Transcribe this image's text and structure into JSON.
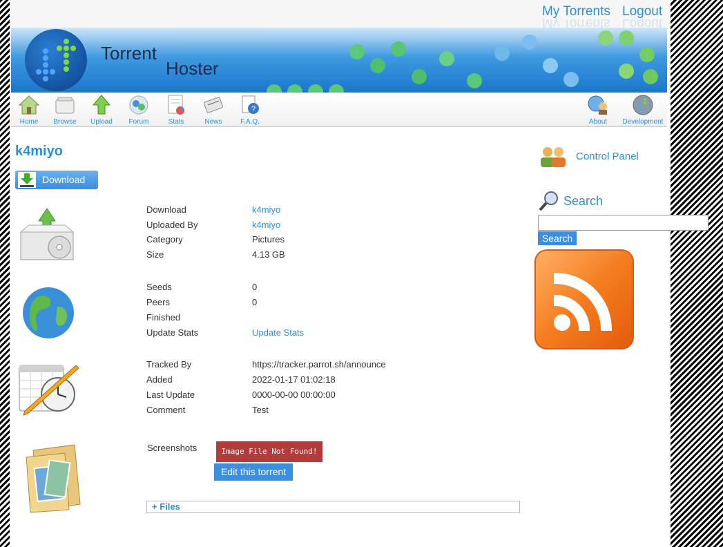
{
  "header": {
    "my_torrents": "My Torrents",
    "logout": "Logout",
    "banner_title_1": "Torrent",
    "banner_title_2": "Hoster"
  },
  "nav": {
    "items": [
      {
        "label": "Home",
        "icon": "home-icon"
      },
      {
        "label": "Browse",
        "icon": "browse-icon"
      },
      {
        "label": "Upload",
        "icon": "upload-icon"
      },
      {
        "label": "Forum",
        "icon": "forum-icon"
      },
      {
        "label": "Stats",
        "icon": "stats-icon"
      },
      {
        "label": "News",
        "icon": "news-icon"
      },
      {
        "label": "F.A.Q.",
        "icon": "faq-icon"
      }
    ],
    "right_items": [
      {
        "label": "About",
        "icon": "about-icon"
      },
      {
        "label": "Development",
        "icon": "development-icon"
      }
    ]
  },
  "torrent": {
    "name": "k4miyo",
    "download_button": "Download",
    "details": [
      {
        "key": "Download",
        "value": "k4miyo",
        "link": true
      },
      {
        "key": "Uploaded By",
        "value": "k4miyo",
        "link": true
      },
      {
        "key": "Category",
        "value": "Pictures",
        "link": false
      },
      {
        "key": "Size",
        "value": "4.13 GB",
        "link": false
      }
    ],
    "stats": [
      {
        "key": "Seeds",
        "value": "0",
        "link": false
      },
      {
        "key": "Peers",
        "value": "0",
        "link": false
      },
      {
        "key": "Finished",
        "value": "",
        "link": false
      },
      {
        "key": "Update Stats",
        "value": "Update Stats",
        "link": true
      }
    ],
    "tracking": [
      {
        "key": "Tracked By",
        "value": "https://tracker.parrot.sh/announce",
        "link": false
      },
      {
        "key": "Added",
        "value": "2022-01-17 01:02:18",
        "link": false
      },
      {
        "key": "Last Update",
        "value": "0000-00-00 00:00:00",
        "link": false
      },
      {
        "key": "Comment",
        "value": "Test",
        "link": false
      }
    ],
    "screenshots_label": "Screenshots",
    "image_not_found": "Image File Not Found!",
    "edit_button": "Edit this torrent",
    "files_toggle": "+ Files"
  },
  "sidebar": {
    "control_panel": "Control Panel",
    "search_title": "Search",
    "search_value": "",
    "search_button": "Search"
  },
  "colors": {
    "link": "#2b8fd8",
    "button": "#3b8ee0",
    "not_found_bg": "#b23b3b",
    "rss": "#f47d1f"
  }
}
